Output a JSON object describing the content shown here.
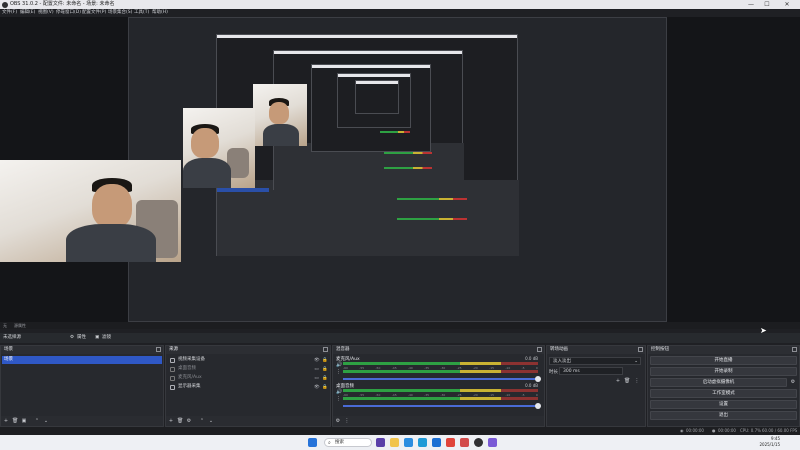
{
  "window": {
    "title": "OBS 31.0.2 - 配置文件: 未命名 - 场景: 未命名",
    "minimize": "—",
    "maximize": "☐",
    "close": "✕"
  },
  "menu": [
    "文件(F)",
    "编辑(E)",
    "视图(V)",
    "停靠窗口(D)",
    "配置文件(P)",
    "场景集合(S)",
    "工具(T)",
    "帮助(H)"
  ],
  "preview_status": {
    "left": "无",
    "source_label": "源属性"
  },
  "source_toolbar": {
    "label": "未选择源",
    "properties": "属性",
    "filters": "滤镜"
  },
  "scenes": {
    "title": "场景",
    "items": [
      "场景"
    ]
  },
  "sources": {
    "title": "来源",
    "items": [
      {
        "label": "视频采集设备",
        "icon": "camera-icon"
      },
      {
        "label": "桌面音频",
        "icon": "speaker-icon"
      },
      {
        "label": "麦克风/Aux",
        "icon": "mic-icon"
      },
      {
        "label": "显示器采集",
        "icon": "monitor-icon"
      }
    ]
  },
  "mixer": {
    "title": "混音器",
    "channels": [
      {
        "name": "麦克风/Aux",
        "db": "0.0 dB"
      },
      {
        "name": "桌面音频",
        "db": "0.0 dB"
      }
    ],
    "ticks": [
      "-60",
      "-55",
      "-50",
      "-45",
      "-40",
      "-35",
      "-30",
      "-25",
      "-20",
      "-15",
      "-10",
      "-5",
      "0"
    ]
  },
  "transitions": {
    "title": "转场动画",
    "selected": "淡入淡出",
    "duration_label": "时长",
    "duration_value": "300 ms"
  },
  "controls": {
    "title": "控制按钮",
    "buttons": [
      "开始直播",
      "开始录制",
      "启动虚拟摄像机",
      "工作室模式",
      "设置",
      "退出"
    ]
  },
  "status": {
    "live": "00:00:00",
    "rec": "00:00:00",
    "cpu": "CPU: 0.7%",
    "fps": "60.00 / 60.00 FPS"
  },
  "taskbar": {
    "search_placeholder": "搜索",
    "time": "9:45",
    "date": "2025/1/15"
  },
  "colors": {
    "accent": "#2f58c6",
    "meter_green": "#2ea043",
    "meter_yellow": "#c9b233",
    "meter_red": "#b63636"
  }
}
